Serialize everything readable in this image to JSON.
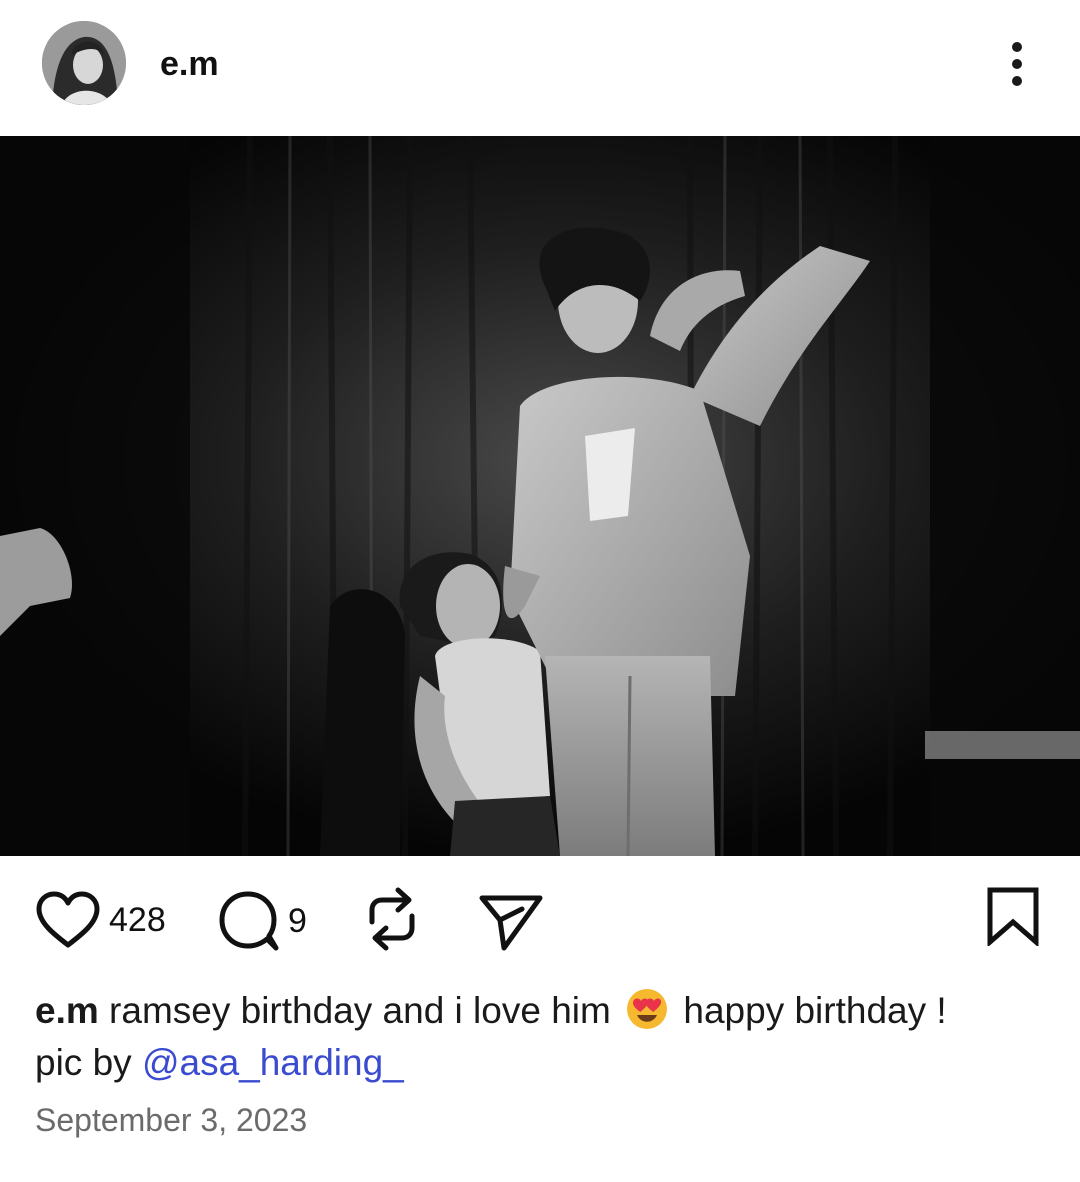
{
  "post": {
    "username": "e.m",
    "likes": "428",
    "comments": "9",
    "caption_user": "e.m",
    "caption_text_1": " ramsey birthday and i love him ",
    "caption_text_2": " happy birthday !",
    "caption_text_3": "pic by ",
    "mention": "@asa_harding_",
    "date": "September 3, 2023"
  },
  "icons": {
    "more": "more-vertical-icon",
    "like": "heart-icon",
    "comment": "comment-icon",
    "repost": "repost-icon",
    "share": "send-icon",
    "save": "bookmark-icon",
    "emoji": "heart-eyes-emoji"
  },
  "colors": {
    "mention": "#3a4bd0",
    "date": "#6b6b6b",
    "emoji_face": "#f5b82e",
    "emoji_hearts": "#e8334a"
  }
}
